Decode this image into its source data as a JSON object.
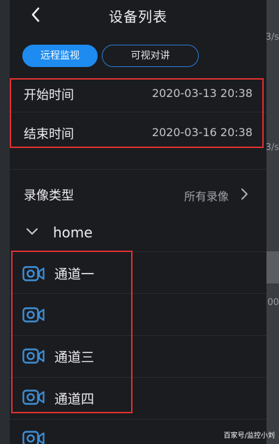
{
  "header": {
    "title": "设备列表"
  },
  "tabs": [
    {
      "label": "远程监视",
      "active": true
    },
    {
      "label": "可视对讲",
      "active": false
    }
  ],
  "time_range": {
    "start_label": "开始时间",
    "start_value": "2020-03-13 20:38",
    "end_label": "结束时间",
    "end_value": "2020-03-16 20:38"
  },
  "record_type": {
    "label": "录像类型",
    "value": "所有录像"
  },
  "group": {
    "name": "home",
    "expanded": true
  },
  "channels": [
    {
      "name": "通道一",
      "icon": "camera-icon"
    },
    {
      "name": "",
      "icon": "camera-icon"
    },
    {
      "name": "通道三",
      "icon": "camera-icon"
    },
    {
      "name": "通道四",
      "icon": "camera-icon"
    },
    {
      "name": "",
      "icon": "camera-icon"
    }
  ],
  "background": {
    "fragment_1": "3/s",
    "fragment_2": "3/s",
    "fragment_3": "00"
  },
  "watermark": "百家号/监控小刘",
  "colors": {
    "accent": "#1e8bf0",
    "icon_blue": "#3e8fd6",
    "highlight_box": "#e03232",
    "panel_bg": "#1b1c20"
  }
}
